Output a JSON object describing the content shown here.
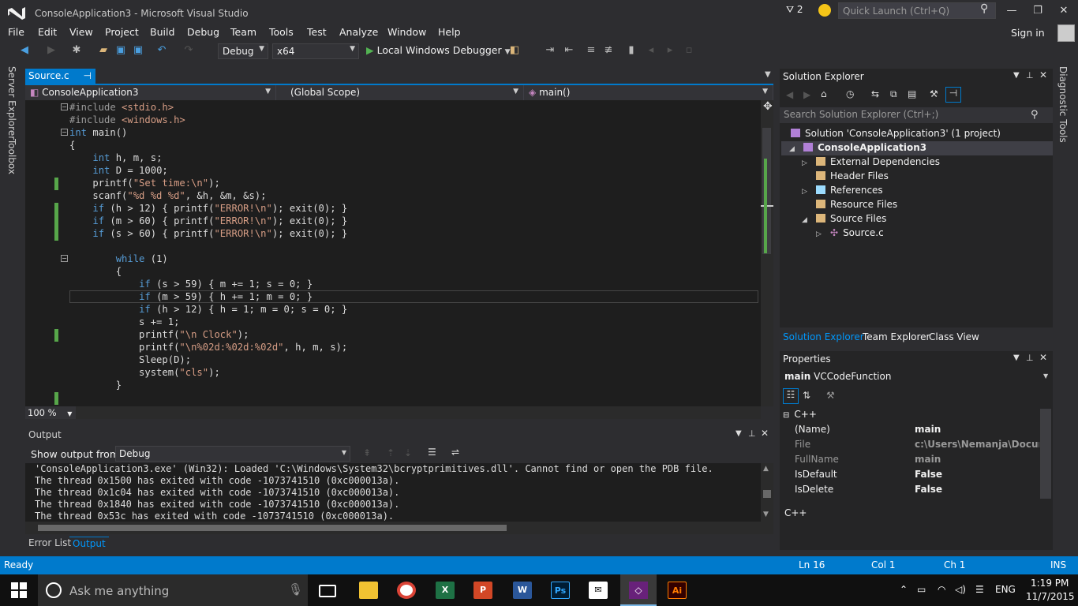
{
  "window": {
    "title": "ConsoleApplication3 - Microsoft Visual Studio",
    "notification_count": "2",
    "quick_launch_placeholder": "Quick Launch (Ctrl+Q)"
  },
  "menu": {
    "items": [
      "File",
      "Edit",
      "View",
      "Project",
      "Build",
      "Debug",
      "Team",
      "Tools",
      "Test",
      "Analyze",
      "Window",
      "Help"
    ],
    "sign_in": "Sign in"
  },
  "toolbar": {
    "configuration": "Debug",
    "platform": "x64",
    "run_label": "Local Windows Debugger"
  },
  "side_tabs": {
    "server_explorer": "Server Explorer",
    "toolbox": "Toolbox",
    "diagnostic_tools": "Diagnostic Tools"
  },
  "document": {
    "tab_label": "Source.c",
    "project_scope": "ConsoleApplication3",
    "global_scope": "(Global Scope)",
    "member": "main()",
    "zoom": "100 %"
  },
  "code_lines": [
    "#include <stdio.h>",
    "#include <windows.h>",
    "int main()",
    "{",
    "    int h, m, s;",
    "    int D = 1000;",
    "    printf(\"Set time:\\n\");",
    "    scanf(\"%d %d %d\", &h, &m, &s);",
    "    if (h > 12) { printf(\"ERROR!\\n\"); exit(0); }",
    "    if (m > 60) { printf(\"ERROR!\\n\"); exit(0); }",
    "    if (s > 60) { printf(\"ERROR!\\n\"); exit(0); }",
    "",
    "        while (1)",
    "        {",
    "            if (s > 59) { m += 1; s = 0; }",
    "            if (m > 59) { h += 1; m = 0; }",
    "            if (h > 12) { h = 1; m = 0; s = 0; }",
    "            s += 1;",
    "            printf(\"\\n Clock\");",
    "            printf(\"\\n%02d:%02d:%02d\", h, m, s);",
    "            Sleep(D);",
    "            system(\"cls\");",
    "        }"
  ],
  "output": {
    "title": "Output",
    "show_from_label": "Show output from:",
    "source": "Debug",
    "lines": [
      "'ConsoleApplication3.exe' (Win32): Loaded 'C:\\Windows\\System32\\bcryptprimitives.dll'. Cannot find or open the PDB file.",
      "The thread 0x1500 has exited with code -1073741510 (0xc000013a).",
      "The thread 0x1c04 has exited with code -1073741510 (0xc000013a).",
      "The thread 0x1840 has exited with code -1073741510 (0xc000013a).",
      "The thread 0x53c has exited with code -1073741510 (0xc000013a)."
    ]
  },
  "bottom_tabs": [
    "Error List",
    "Output"
  ],
  "solution_explorer": {
    "title": "Solution Explorer",
    "search_placeholder": "Search Solution Explorer (Ctrl+;)",
    "solution": "Solution 'ConsoleApplication3' (1 project)",
    "project": "ConsoleApplication3",
    "nodes": [
      "External Dependencies",
      "Header Files",
      "References",
      "Resource Files",
      "Source Files"
    ],
    "file": "Source.c",
    "tabs": [
      "Solution Explorer",
      "Team Explorer",
      "Class View"
    ]
  },
  "properties": {
    "title": "Properties",
    "object_name": "main",
    "object_type": "VCCodeFunction",
    "category": "C++",
    "rows": [
      {
        "name": "(Name)",
        "value": "main"
      },
      {
        "name": "File",
        "value": "c:\\Users\\Nemanja\\Documen"
      },
      {
        "name": "FullName",
        "value": "main"
      },
      {
        "name": "IsDefault",
        "value": "False"
      },
      {
        "name": "IsDelete",
        "value": "False"
      }
    ],
    "description": "C++"
  },
  "status": {
    "state": "Ready",
    "line": "Ln 16",
    "col": "Col 1",
    "ch": "Ch 1",
    "mode": "INS"
  },
  "taskbar": {
    "search_placeholder": "Ask me anything",
    "language": "ENG",
    "time": "1:19 PM",
    "date": "11/7/2015"
  },
  "colors": {
    "accent": "#007acc",
    "editor_bg": "#1e1e1e",
    "keyword": "#569cd6",
    "string": "#d69d85",
    "change_bar": "#57a64a"
  }
}
